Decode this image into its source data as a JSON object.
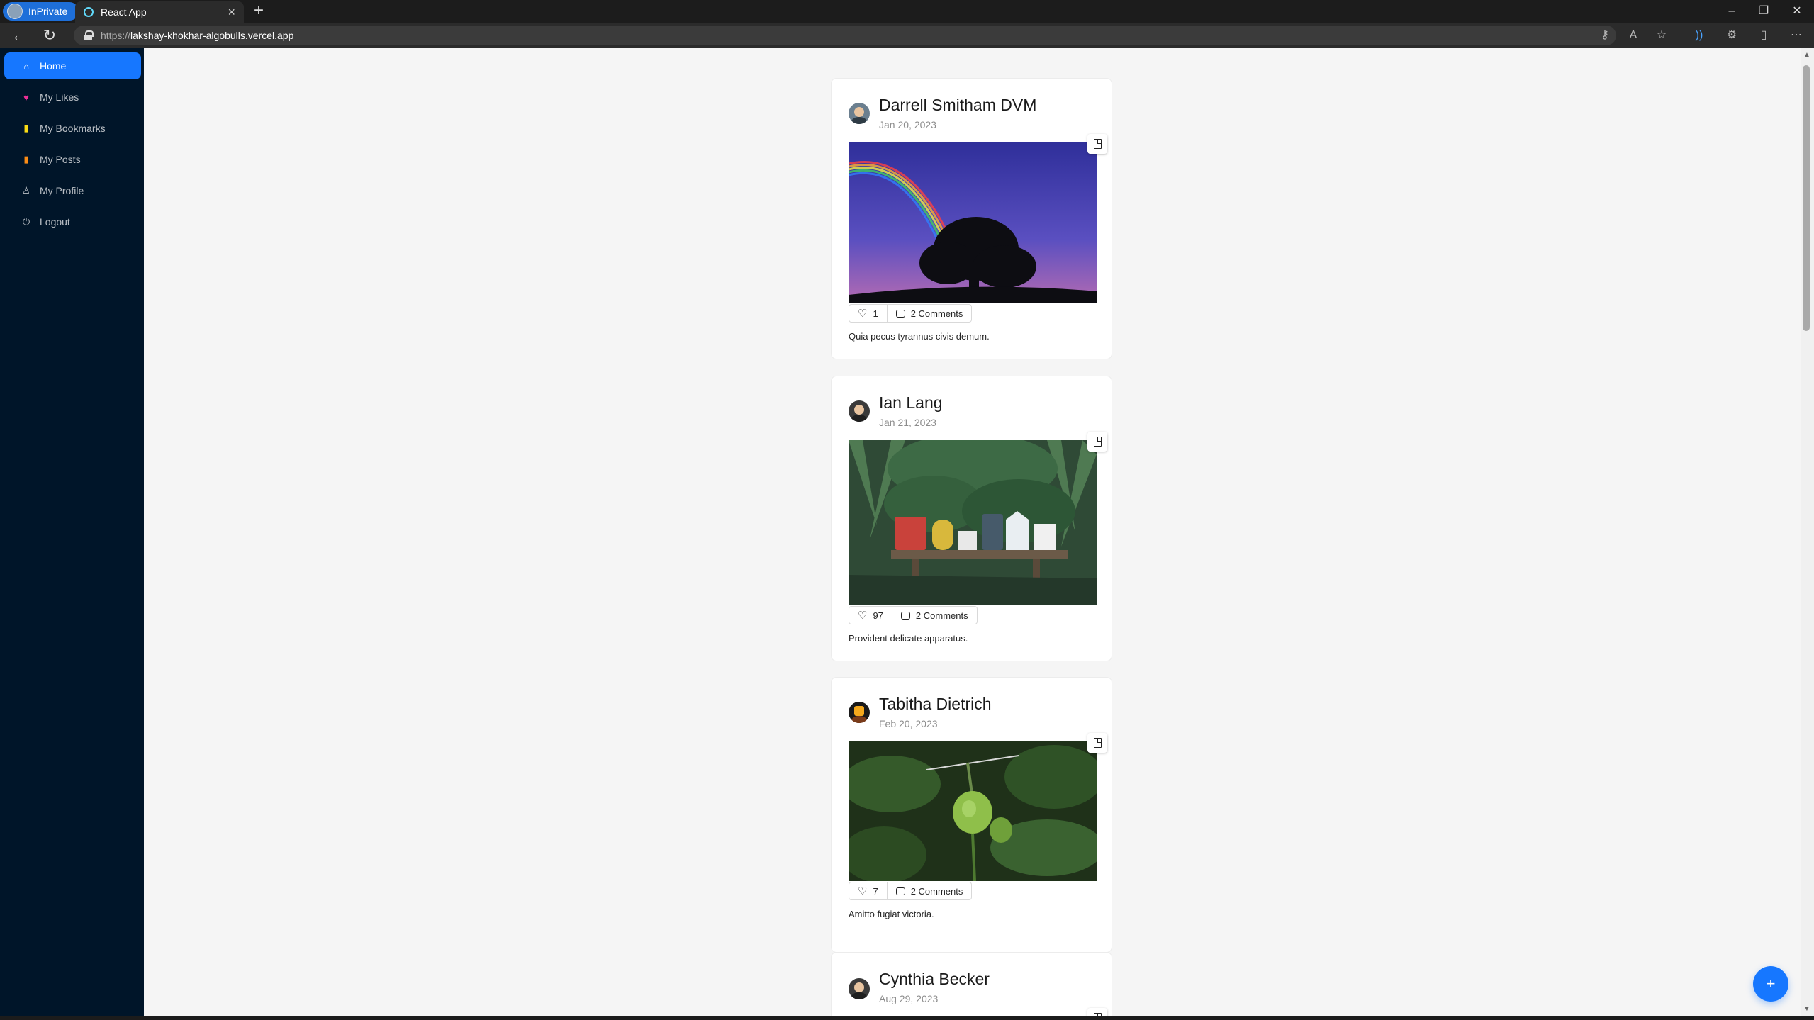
{
  "browser": {
    "inprivate_label": "InPrivate",
    "tab_title": "React App",
    "url_prefix": "https://",
    "url_host": "lakshay-khokhar-algobulls.vercel.app"
  },
  "sidebar": {
    "items": [
      {
        "label": "Home",
        "icon": "home-icon",
        "active": true
      },
      {
        "label": "My Likes",
        "icon": "heart-icon",
        "active": false
      },
      {
        "label": "My Bookmarks",
        "icon": "bookmark-icon",
        "active": false
      },
      {
        "label": "My Posts",
        "icon": "posts-icon",
        "active": false
      },
      {
        "label": "My Profile",
        "icon": "user-icon",
        "active": false
      },
      {
        "label": "Logout",
        "icon": "logout-icon",
        "active": false
      }
    ]
  },
  "posts": [
    {
      "author": "Darrell Smitham DVM",
      "date": "Jan 20, 2023",
      "likes": "1",
      "comments": "2 Comments",
      "caption": "Quia pecus tyrannus civis demum.",
      "image": "rainbow-tree"
    },
    {
      "author": "Ian Lang",
      "date": "Jan 21, 2023",
      "likes": "97",
      "comments": "2 Comments",
      "caption": "Provident delicate apparatus.",
      "image": "mailboxes"
    },
    {
      "author": "Tabitha Dietrich",
      "date": "Feb 20, 2023",
      "likes": "7",
      "comments": "2 Comments",
      "caption": "Amitto fugiat victoria.",
      "image": "tomato-plant"
    },
    {
      "author": "Cynthia Becker",
      "date": "Aug 29, 2023"
    }
  ],
  "fab": {
    "label": "+"
  },
  "colors": {
    "sidebar": "#001529",
    "accent": "#1677ff",
    "background": "#f5f5f5"
  }
}
